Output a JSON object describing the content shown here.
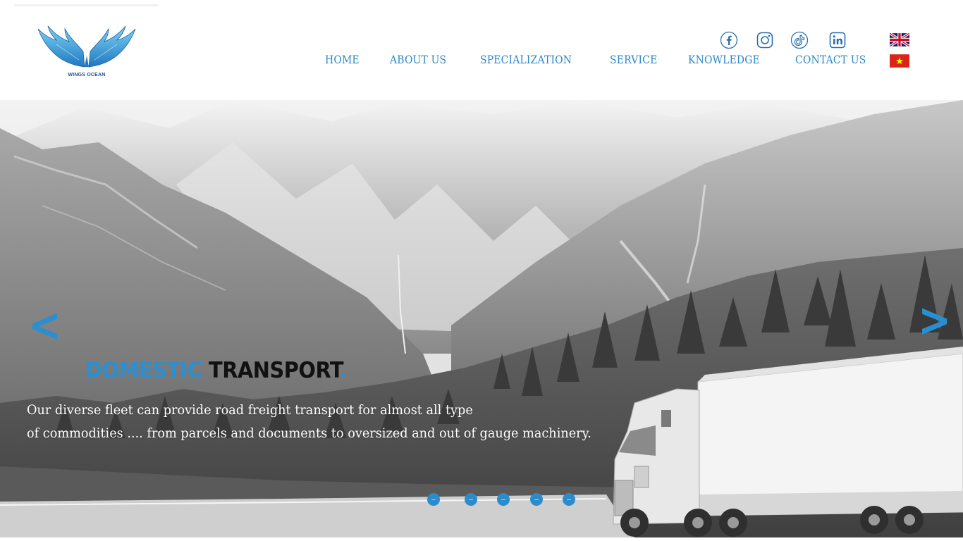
{
  "brand": {
    "logo_text": "WINGS OCEAN",
    "logo_icon": "wings-icon"
  },
  "social": [
    {
      "name": "facebook",
      "icon": "facebook-icon"
    },
    {
      "name": "instagram",
      "icon": "instagram-icon"
    },
    {
      "name": "tiktok",
      "icon": "tiktok-icon"
    },
    {
      "name": "linkedin",
      "icon": "linkedin-icon"
    }
  ],
  "languages": [
    {
      "code": "en",
      "icon": "uk-flag-icon"
    },
    {
      "code": "vi",
      "icon": "vietnam-flag-icon"
    }
  ],
  "nav": {
    "items": [
      {
        "label": "HOME"
      },
      {
        "label": "ABOUT US"
      },
      {
        "label": "SPECIALIZATION"
      },
      {
        "label": "SERVICE"
      },
      {
        "label": "KNOWLEDGE"
      },
      {
        "label": "CONTACT US"
      }
    ]
  },
  "hero": {
    "title_part1": "DOMESTIC",
    "title_part2": "TRANSPORT",
    "title_dot": ".",
    "desc_line1": "Our diverse fleet can provide road freight transport for almost all type",
    "desc_line2": "of commodities .... from parcels and documents to oversized and out of gauge machinery.",
    "prev_arrow": "<",
    "next_arrow": ">",
    "slide_count": 5
  },
  "colors": {
    "accent": "#2a88c9",
    "title_dark": "#111111",
    "text_light": "#ffffff"
  }
}
